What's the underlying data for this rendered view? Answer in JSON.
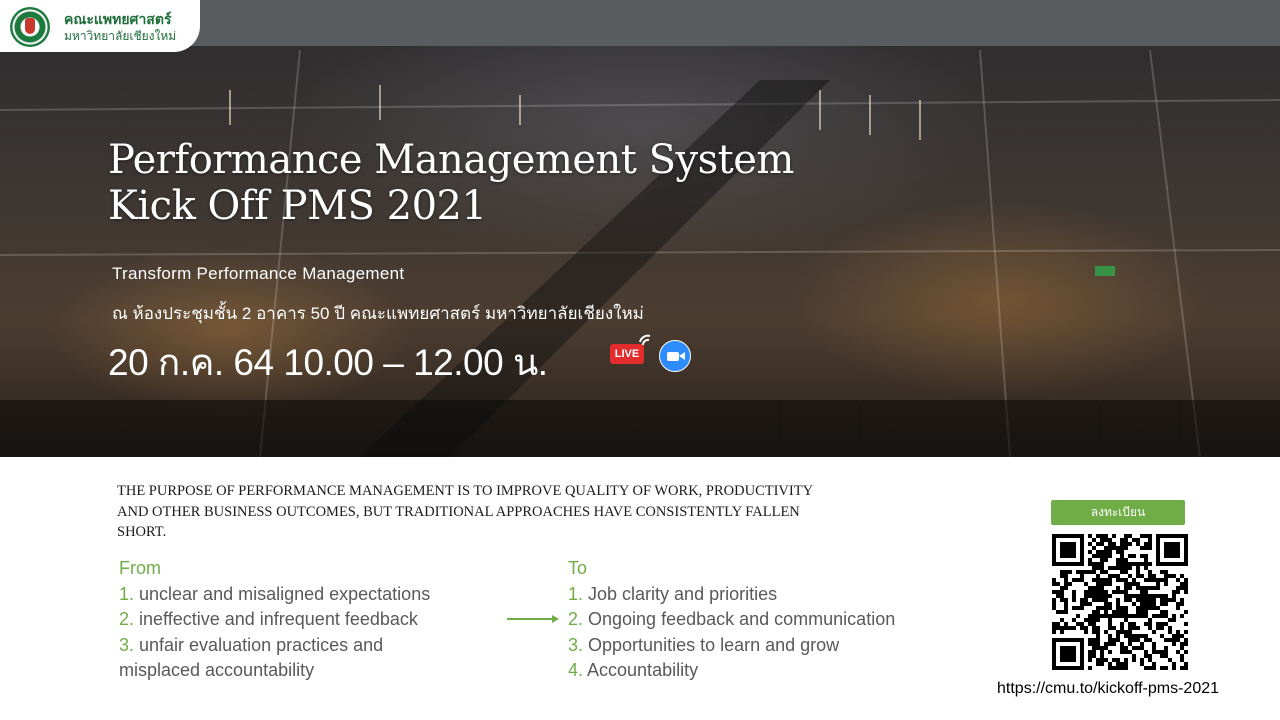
{
  "header": {
    "logo_name_line1": "คณะแพทยศาสตร์",
    "logo_name_line2": "มหาวิทยาลัยเชียงใหม่"
  },
  "hero": {
    "title_line1": "Performance Management System",
    "title_line2": "Kick Off PMS 2021",
    "subtitle": "Transform Performance Management",
    "venue": "ณ ห้องประชุมชั้น 2 อาคาร 50 ปี คณะแพทยศาสตร์ มหาวิทยาลัยเชียงใหม่",
    "datetime": "20 ก.ค. 64 10.00 – 12.00 น.",
    "live_label": "LIVE",
    "icons": [
      "live-icon",
      "zoom-icon"
    ]
  },
  "purpose": "THE PURPOSE OF PERFORMANCE MANAGEMENT IS TO IMPROVE QUALITY OF WORK, PRODUCTIVITY AND OTHER BUSINESS OUTCOMES, BUT TRADITIONAL APPROACHES HAVE CONSISTENTLY FALLEN SHORT.",
  "from": {
    "heading": "From",
    "items": [
      {
        "num": "1.",
        "text": " unclear and misaligned  expectations"
      },
      {
        "num": "2.",
        "text": " ineffective and infrequent  feedback"
      },
      {
        "num": "3.",
        "text": " unfair evaluation practices and"
      }
    ],
    "continuation": "misplaced  accountability"
  },
  "to": {
    "heading": "To",
    "items": [
      {
        "num": "1.",
        "text": " Job clarity and priorities"
      },
      {
        "num": "2.",
        "text": " Ongoing  feedback  and communication"
      },
      {
        "num": "3.",
        "text": " Opportunities  to learn and grow"
      },
      {
        "num": "4.",
        "text": " Accountability"
      }
    ]
  },
  "register": {
    "button_label": "ลงทะเบียน",
    "url": "https://cmu.to/kickoff-pms-2021"
  },
  "colors": {
    "accent_green": "#70ad47",
    "topbar_gray": "#5b5c60",
    "body_text": "#595959"
  }
}
